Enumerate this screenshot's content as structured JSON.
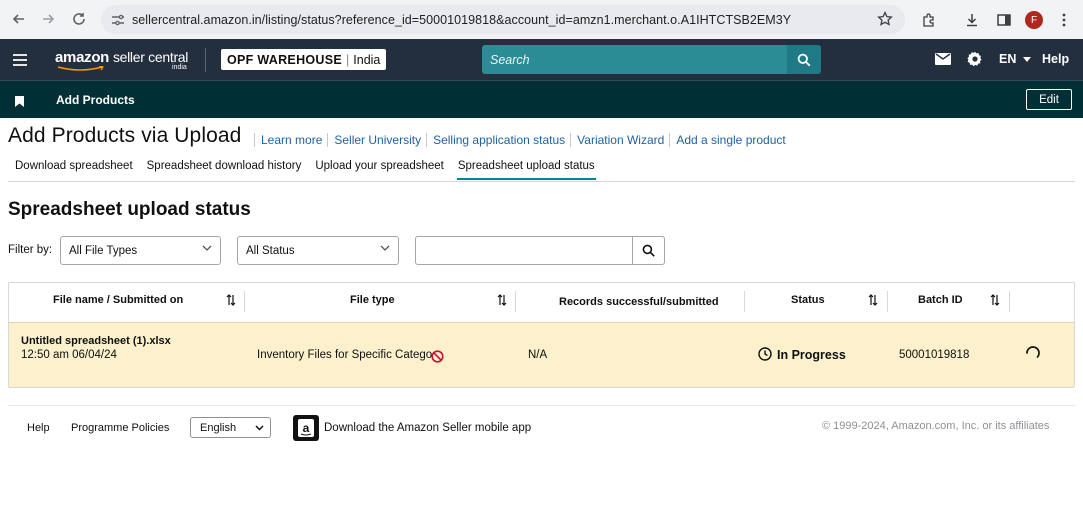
{
  "browser": {
    "url": "sellercentral.amazon.in/listing/status?reference_id=50001019818&account_id=amzn1.merchant.o.A1IHTCTSB2EM3Y",
    "profile_initial": "F"
  },
  "header": {
    "logo_main": "amazon",
    "logo_sub": "seller central",
    "logo_region": "india",
    "store_name": "OPF WAREHOUSE",
    "store_region": "India",
    "search_placeholder": "Search",
    "language": "EN",
    "help": "Help"
  },
  "subheader": {
    "title": "Add Products",
    "edit": "Edit"
  },
  "page": {
    "title": "Add Products via Upload",
    "links": [
      "Learn more",
      "Seller University",
      "Selling application status",
      "Variation Wizard",
      "Add a single product"
    ],
    "tabs": [
      "Download spreadsheet",
      "Spreadsheet download history",
      "Upload your spreadsheet",
      "Spreadsheet upload status"
    ],
    "active_tab": "Spreadsheet upload status",
    "section_title": "Spreadsheet upload status"
  },
  "filters": {
    "label": "Filter by:",
    "file_type": "All File Types",
    "status": "All Status",
    "search_value": ""
  },
  "table": {
    "headers": [
      "File name / Submitted on",
      "File type",
      "Records successful/submitted",
      "Status",
      "Batch ID"
    ],
    "rows": [
      {
        "file_name": "Untitled spreadsheet (1).xlsx",
        "submitted_on": "12:50 am 06/04/24",
        "file_type": "Inventory Files for Specific Categor",
        "records": "N/A",
        "status": "In Progress",
        "batch_id": "50001019818"
      }
    ]
  },
  "footer": {
    "help": "Help",
    "policies": "Programme Policies",
    "language": "English",
    "app_link": "Download the Amazon Seller mobile app",
    "copyright": "© 1999-2024, Amazon.com, Inc. or its affiliates"
  },
  "colors": {
    "header_bg": "#232f3e",
    "subheader_bg": "#002f36",
    "search_bg": "#2b8c96",
    "link": "#2162a1",
    "row_highlight": "#fcf1cc",
    "tab_underline": "#008296"
  }
}
